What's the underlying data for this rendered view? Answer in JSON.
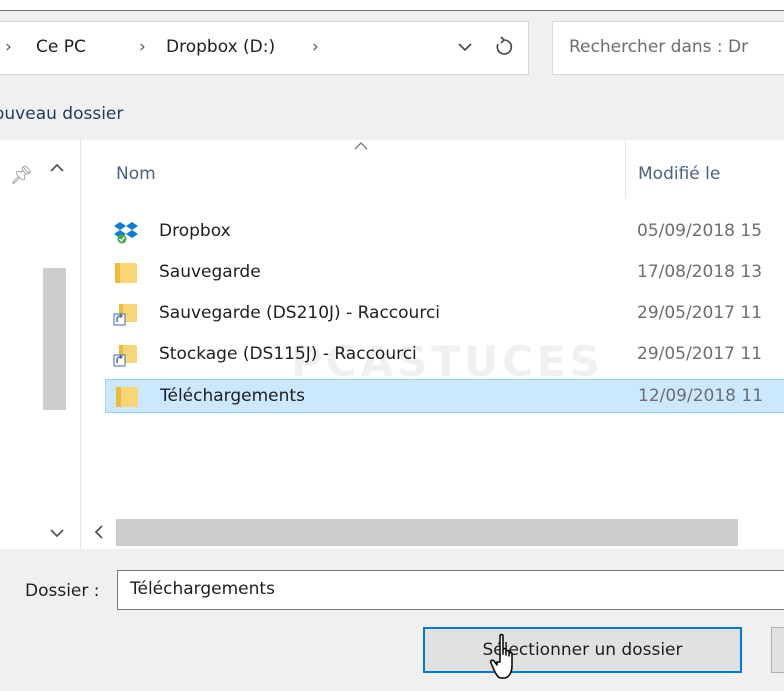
{
  "address_bar": {
    "segments": [
      "Ce PC",
      "Dropbox (D:)"
    ],
    "separator": "›"
  },
  "search": {
    "placeholder": "Rechercher dans : Dr"
  },
  "toolbar": {
    "new_folder_label": "ouveau dossier"
  },
  "file_list": {
    "columns": [
      "Nom",
      "Modifié le"
    ],
    "rows": [
      {
        "name": "Dropbox",
        "date": "05/09/2018 15",
        "icon": "dropbox-icon"
      },
      {
        "name": "Sauvegarde",
        "date": "17/08/2018 13",
        "icon": "folder-icon"
      },
      {
        "name": "Sauvegarde (DS210J) - Raccourci",
        "date": "29/05/2017 11",
        "icon": "folder-shortcut-icon"
      },
      {
        "name": "Stockage (DS115J) - Raccourci",
        "date": "29/05/2017 11",
        "icon": "folder-shortcut-icon"
      },
      {
        "name": "Téléchargements",
        "date": "12/09/2018 11",
        "icon": "folder-icon",
        "selected": true
      }
    ]
  },
  "watermark": "PCASTUCES",
  "bottom": {
    "folder_label": "Dossier :",
    "folder_value": "Téléchargements",
    "select_button": "Sélectionner un dossier"
  },
  "colors": {
    "selection_bg": "#cce8ff",
    "selection_border": "#99d1ff",
    "focus_border": "#0078d7",
    "header_text": "#4d6082"
  }
}
